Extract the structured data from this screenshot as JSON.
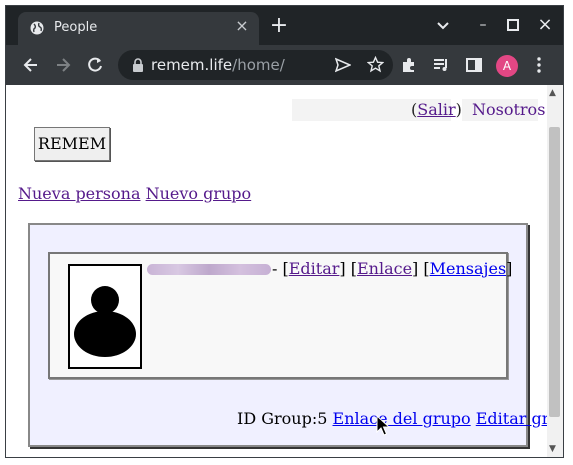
{
  "browser": {
    "tab_title": "People",
    "tab_close_glyph": "×",
    "new_tab_glyph": "+",
    "window_controls": {
      "minimize": "–",
      "maximize": "□",
      "close": "×"
    },
    "url_host": "remem.life",
    "url_path": "/home/",
    "profile_initial": "A",
    "profile_color": "#e24784",
    "icons": [
      "back-icon",
      "forward-icon",
      "reload-icon",
      "lock-icon",
      "send-icon",
      "star-icon",
      "extensions-icon",
      "media-icon",
      "sidebar-icon",
      "menu-icon"
    ]
  },
  "page": {
    "salir_open": "(",
    "salir_label": "Salir",
    "salir_close": ")",
    "nosotros_label": "Nosotros",
    "logo_label": "REMEM",
    "new_person_label": "Nueva persona",
    "new_group_label": "Nuevo grupo",
    "person": {
      "separator": "-",
      "edit_label": "Editar",
      "link_label": "Enlace",
      "messages_label": "Mensajes"
    },
    "group": {
      "id_label": "ID Group:",
      "id_value": "5",
      "link_label": "Enlace del grupo",
      "edit_label": "Editar grupo"
    }
  },
  "colors": {
    "visited_link": "#551a8b",
    "unvisited_link": "#0000ee",
    "panel_bg": "#f0f0ff"
  }
}
